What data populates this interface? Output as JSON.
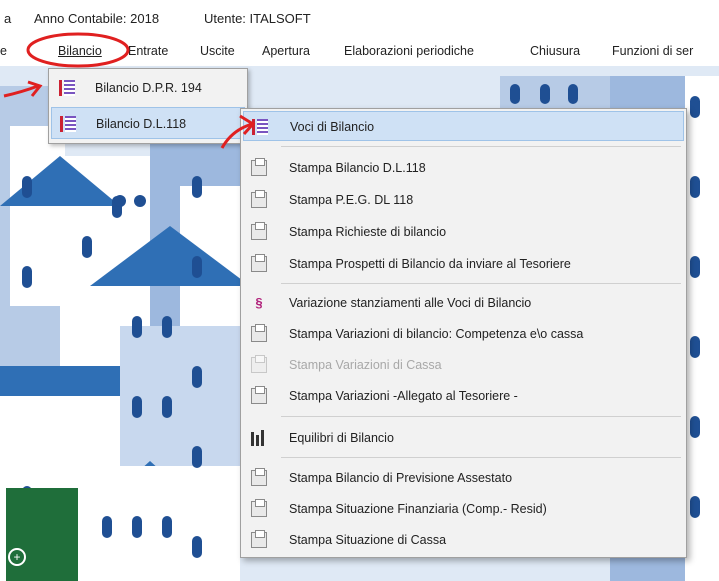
{
  "titlebar": {
    "prefix": "a",
    "anno": "Anno Contabile: 2018",
    "utente": "Utente: ITALSOFT"
  },
  "menubar": {
    "items": [
      {
        "label": "e"
      },
      {
        "label": "Bilancio"
      },
      {
        "label": "Entrate"
      },
      {
        "label": "Uscite"
      },
      {
        "label": "Apertura"
      },
      {
        "label": "Elaborazioni periodiche"
      },
      {
        "label": "Chiusura"
      },
      {
        "label": "Funzioni di ser"
      }
    ]
  },
  "menu_bilancio": {
    "items": [
      {
        "label": "Bilancio D.P.R. 194",
        "icon": "ledger-icon"
      },
      {
        "label": "Bilancio D.L.118",
        "icon": "ledger-icon"
      }
    ]
  },
  "submenu_dl118": {
    "items": [
      {
        "label": "Voci di Bilancio",
        "icon": "ledger-icon"
      },
      {
        "label": "Stampa Bilancio D.L.118",
        "icon": "print-icon"
      },
      {
        "label": "Stampa P.E.G.  DL 118",
        "icon": "print-icon"
      },
      {
        "label": "Stampa Richieste di bilancio",
        "icon": "print-icon"
      },
      {
        "label": "Stampa Prospetti di Bilancio da inviare al Tesoriere",
        "icon": "print-icon"
      },
      {
        "label": "Variazione stanziamenti alle Voci di Bilancio",
        "icon": "variation-icon"
      },
      {
        "label": "Stampa Variazioni di bilancio: Competenza e\\o cassa",
        "icon": "print-icon"
      },
      {
        "label": "Stampa Variazioni di Cassa",
        "icon": "print-icon",
        "disabled": true
      },
      {
        "label": "Stampa Variazioni -Allegato al Tesoriere -",
        "icon": "print-icon"
      },
      {
        "label": "Equilibri di Bilancio",
        "icon": "bar-chart-icon"
      },
      {
        "label": "Stampa Bilancio di Previsione Assestato",
        "icon": "print-icon"
      },
      {
        "label": "Stampa Situazione Finanziaria (Comp.- Resid)",
        "icon": "print-icon"
      },
      {
        "label": "Stampa Situazione di Cassa",
        "icon": "print-icon"
      }
    ]
  },
  "colors": {
    "highlight": "#cfe1f5",
    "annotation": "#e02020",
    "building_blue": "#2f6fb5",
    "green_panel": "#1f6e3a"
  }
}
